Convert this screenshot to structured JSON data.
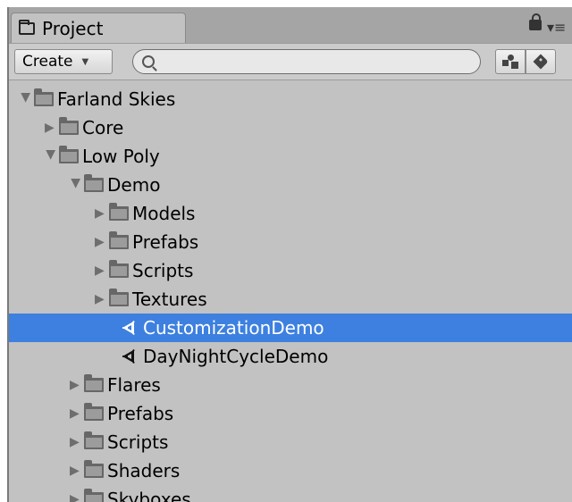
{
  "tab": {
    "label": "Project"
  },
  "toolbar": {
    "create_label": "Create",
    "search_value": "",
    "search_placeholder": ""
  },
  "tree": [
    {
      "label": "Farland Skies",
      "depth": 0,
      "type": "folder",
      "expanded": true,
      "selected": false
    },
    {
      "label": "Core",
      "depth": 1,
      "type": "folder",
      "expanded": false,
      "selected": false
    },
    {
      "label": "Low Poly",
      "depth": 1,
      "type": "folder",
      "expanded": true,
      "selected": false
    },
    {
      "label": "Demo",
      "depth": 2,
      "type": "folder",
      "expanded": true,
      "selected": false
    },
    {
      "label": "Models",
      "depth": 3,
      "type": "folder",
      "expanded": false,
      "selected": false
    },
    {
      "label": "Prefabs",
      "depth": 3,
      "type": "folder",
      "expanded": false,
      "selected": false
    },
    {
      "label": "Scripts",
      "depth": 3,
      "type": "folder",
      "expanded": false,
      "selected": false
    },
    {
      "label": "Textures",
      "depth": 3,
      "type": "folder",
      "expanded": false,
      "selected": false
    },
    {
      "label": "CustomizationDemo",
      "depth": 4,
      "type": "scene",
      "expanded": false,
      "selected": true
    },
    {
      "label": "DayNightCycleDemo",
      "depth": 4,
      "type": "scene",
      "expanded": false,
      "selected": false
    },
    {
      "label": "Flares",
      "depth": 2,
      "type": "folder",
      "expanded": false,
      "selected": false
    },
    {
      "label": "Prefabs",
      "depth": 2,
      "type": "folder",
      "expanded": false,
      "selected": false
    },
    {
      "label": "Scripts",
      "depth": 2,
      "type": "folder",
      "expanded": false,
      "selected": false
    },
    {
      "label": "Shaders",
      "depth": 2,
      "type": "folder",
      "expanded": false,
      "selected": false
    },
    {
      "label": "Skyboxes",
      "depth": 2,
      "type": "folder",
      "expanded": false,
      "selected": false
    }
  ],
  "icons": {
    "tab": "folder-tab-icon",
    "lock": "lock-icon",
    "menu": "panel-menu-icon",
    "search": "search-icon",
    "filter": "filter-by-type-icon",
    "label": "filter-by-label-icon",
    "folder": "folder-icon",
    "scene": "unity-scene-icon"
  },
  "colors": {
    "selection": "#3d80df",
    "panel": "#c2c2c2",
    "tabbar": "#a5a5a5"
  }
}
